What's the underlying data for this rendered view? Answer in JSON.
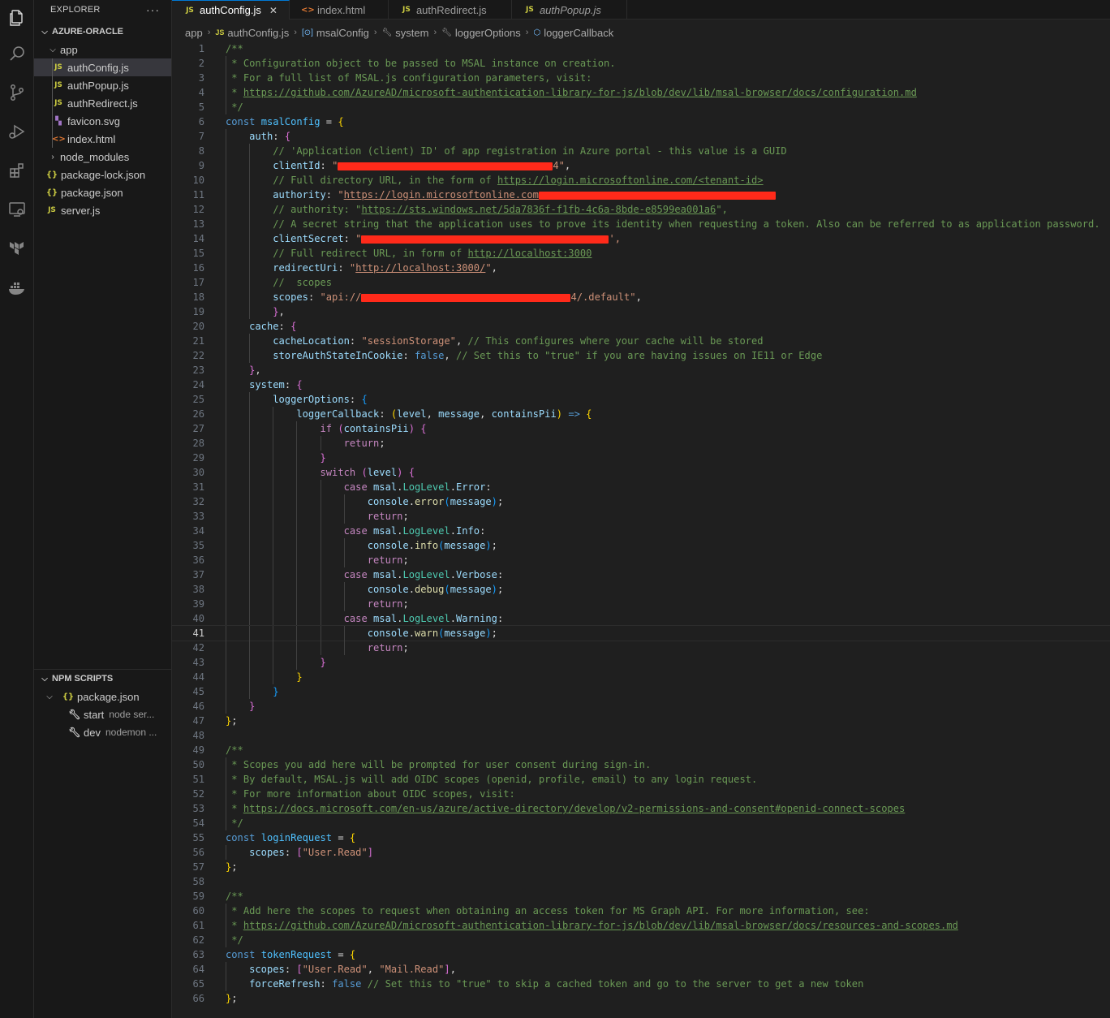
{
  "activity_bar": [
    "files-icon",
    "search-icon",
    "source-control-icon",
    "run-debug-icon",
    "extensions-icon",
    "remote-explorer-icon",
    "terraform-icon",
    "docker-icon"
  ],
  "sidebar": {
    "title": "EXPLORER",
    "more": "···",
    "folder": "AZURE-ORACLE",
    "tree": [
      {
        "label": "app",
        "type": "folder-open"
      },
      {
        "label": "authConfig.js",
        "type": "js"
      },
      {
        "label": "authPopup.js",
        "type": "js"
      },
      {
        "label": "authRedirect.js",
        "type": "js"
      },
      {
        "label": "favicon.svg",
        "type": "svg"
      },
      {
        "label": "index.html",
        "type": "html"
      },
      {
        "label": "node_modules",
        "type": "folder-closed"
      },
      {
        "label": "package-lock.json",
        "type": "json"
      },
      {
        "label": "package.json",
        "type": "json"
      },
      {
        "label": "server.js",
        "type": "js"
      }
    ],
    "npm_scripts": {
      "title": "NPM SCRIPTS",
      "file": "package.json",
      "scripts": [
        {
          "name": "start",
          "command": "node ser..."
        },
        {
          "name": "dev",
          "command": "nodemon ..."
        }
      ]
    }
  },
  "tabs": [
    {
      "label": "authConfig.js",
      "icon": "JS",
      "active": true
    },
    {
      "label": "index.html",
      "icon": "<>"
    },
    {
      "label": "authRedirect.js",
      "icon": "JS"
    },
    {
      "label": "authPopup.js",
      "icon": "JS",
      "preview": true
    }
  ],
  "breadcrumb": [
    "app",
    "authConfig.js",
    "msalConfig",
    "system",
    "loggerOptions",
    "loggerCallback"
  ],
  "editor": {
    "current_line": 41,
    "lines": [
      "/**",
      " * Configuration object to be passed to MSAL instance on creation.",
      " * For a full list of MSAL.js configuration parameters, visit:",
      " * https://github.com/AzureAD/microsoft-authentication-library-for-js/blob/dev/lib/msal-browser/docs/configuration.md",
      " */",
      "const msalConfig = {",
      "    auth: {",
      "        // 'Application (client) ID' of app registration in Azure portal - this value is a GUID",
      "        clientId: \"4\",",
      "        // Full directory URL, in the form of https://login.microsoftonline.com/<tenant-id>",
      "        authority: \"https://login.microsoftonline.com",
      "        // authority: \"https://sts.windows.net/5da7836f-f1fb-4c6a-8bde-e8599ea001a6\",",
      "        // A secret string that the application uses to prove its identity when requesting a token. Also can be referred to as application password.",
      "        clientSecret: \"',",
      "        // Full redirect URL, in form of http://localhost:3000",
      "        redirectUri: \"http://localhost:3000/\",",
      "        //  scopes",
      "        scopes: \"api://4/.default\",",
      "        },",
      "    cache: {",
      "        cacheLocation: \"sessionStorage\", // This configures where your cache will be stored",
      "        storeAuthStateInCookie: false, // Set this to \"true\" if you are having issues on IE11 or Edge",
      "    },",
      "    system: {",
      "        loggerOptions: {",
      "            loggerCallback: (level, message, containsPii) => {",
      "                if (containsPii) {",
      "                    return;",
      "                }",
      "                switch (level) {",
      "                    case msal.LogLevel.Error:",
      "                        console.error(message);",
      "                        return;",
      "                    case msal.LogLevel.Info:",
      "                        console.info(message);",
      "                        return;",
      "                    case msal.LogLevel.Verbose:",
      "                        console.debug(message);",
      "                        return;",
      "                    case msal.LogLevel.Warning:",
      "                        console.warn(message);",
      "                        return;",
      "                }",
      "            }",
      "        }",
      "    }",
      "};",
      "",
      "/**",
      " * Scopes you add here will be prompted for user consent during sign-in.",
      " * By default, MSAL.js will add OIDC scopes (openid, profile, email) to any login request.",
      " * For more information about OIDC scopes, visit:",
      " * https://docs.microsoft.com/en-us/azure/active-directory/develop/v2-permissions-and-consent#openid-connect-scopes",
      " */",
      "const loginRequest = {",
      "    scopes: [\"User.Read\"]",
      "};",
      "",
      "/**",
      " * Add here the scopes to request when obtaining an access token for MS Graph API. For more information, see:",
      " * https://github.com/AzureAD/microsoft-authentication-library-for-js/blob/dev/lib/msal-browser/docs/resources-and-scopes.md",
      " */",
      "const tokenRequest = {",
      "    scopes: [\"User.Read\", \"Mail.Read\"],",
      "    forceRefresh: false // Set this to \"true\" to skip a cached token and go to the server to get a new token",
      "};"
    ]
  },
  "colors": {
    "accent": "#0078d4",
    "redaction": "#ff2a1a",
    "comment": "#6a9955",
    "keyword": "#569cd6",
    "string": "#ce9178"
  }
}
